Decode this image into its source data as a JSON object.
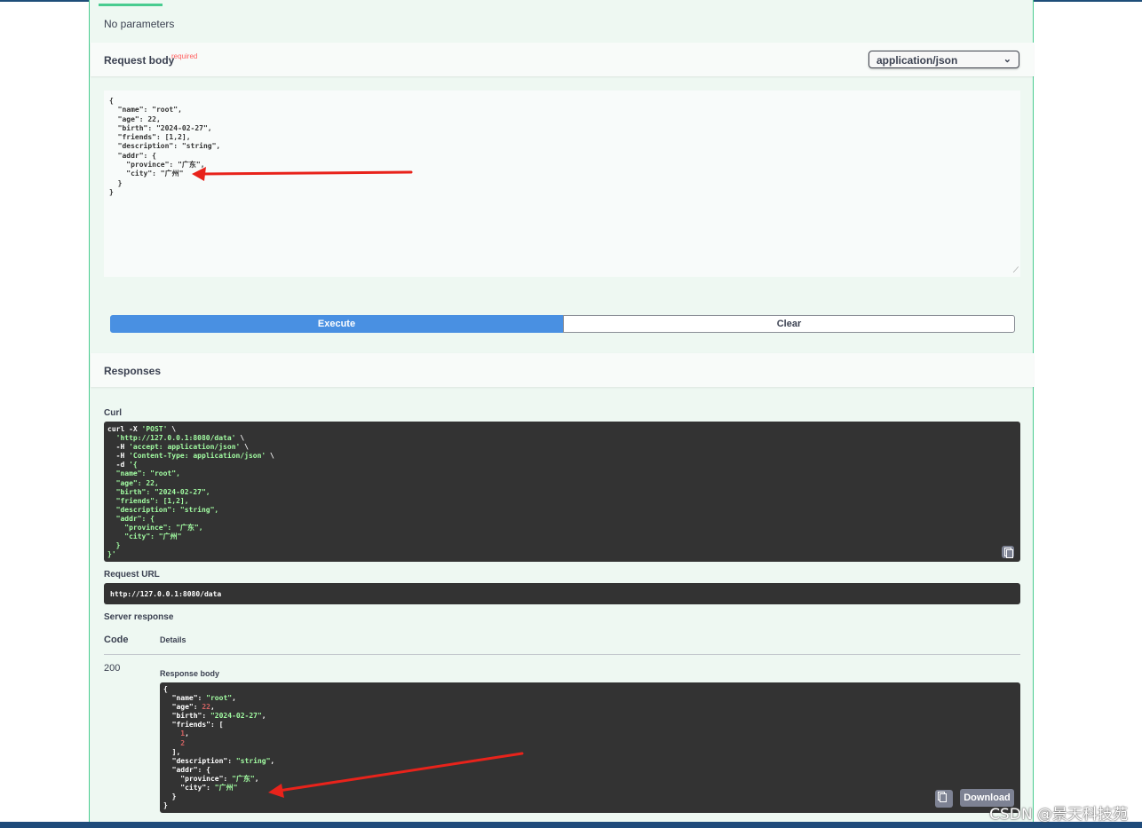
{
  "parameters": {
    "empty_text": "No parameters"
  },
  "request_body": {
    "title": "Request body",
    "required_label": "required",
    "content_type": "application/json",
    "editor_text": "{\n  \"name\": \"root\",\n  \"age\": 22,\n  \"birth\": \"2024-02-27\",\n  \"friends\": [1,2],\n  \"description\": \"string\",\n  \"addr\": {\n    \"province\": \"广东\",\n    \"city\": \"广州\"\n  }\n}"
  },
  "actions": {
    "execute_label": "Execute",
    "clear_label": "Clear"
  },
  "responses": {
    "title": "Responses",
    "curl_label": "Curl",
    "request_url_label": "Request URL",
    "request_url": "http://127.0.0.1:8080/data",
    "server_response_label": "Server response",
    "code_header": "Code",
    "details_header": "Details",
    "status_code": "200",
    "response_body_label": "Response body",
    "download_label": "Download"
  },
  "icons": {
    "copy": "clipboard-icon",
    "select": "chevron-down-icon"
  },
  "colors": {
    "accent_green": "#49cc90",
    "execute_blue": "#4990e2",
    "code_bg": "#333333",
    "string_green": "#a2fca2",
    "number_red": "#d36363",
    "annotation_arrow": "#e8231b"
  },
  "watermark": "CSDN @景天科技苑"
}
